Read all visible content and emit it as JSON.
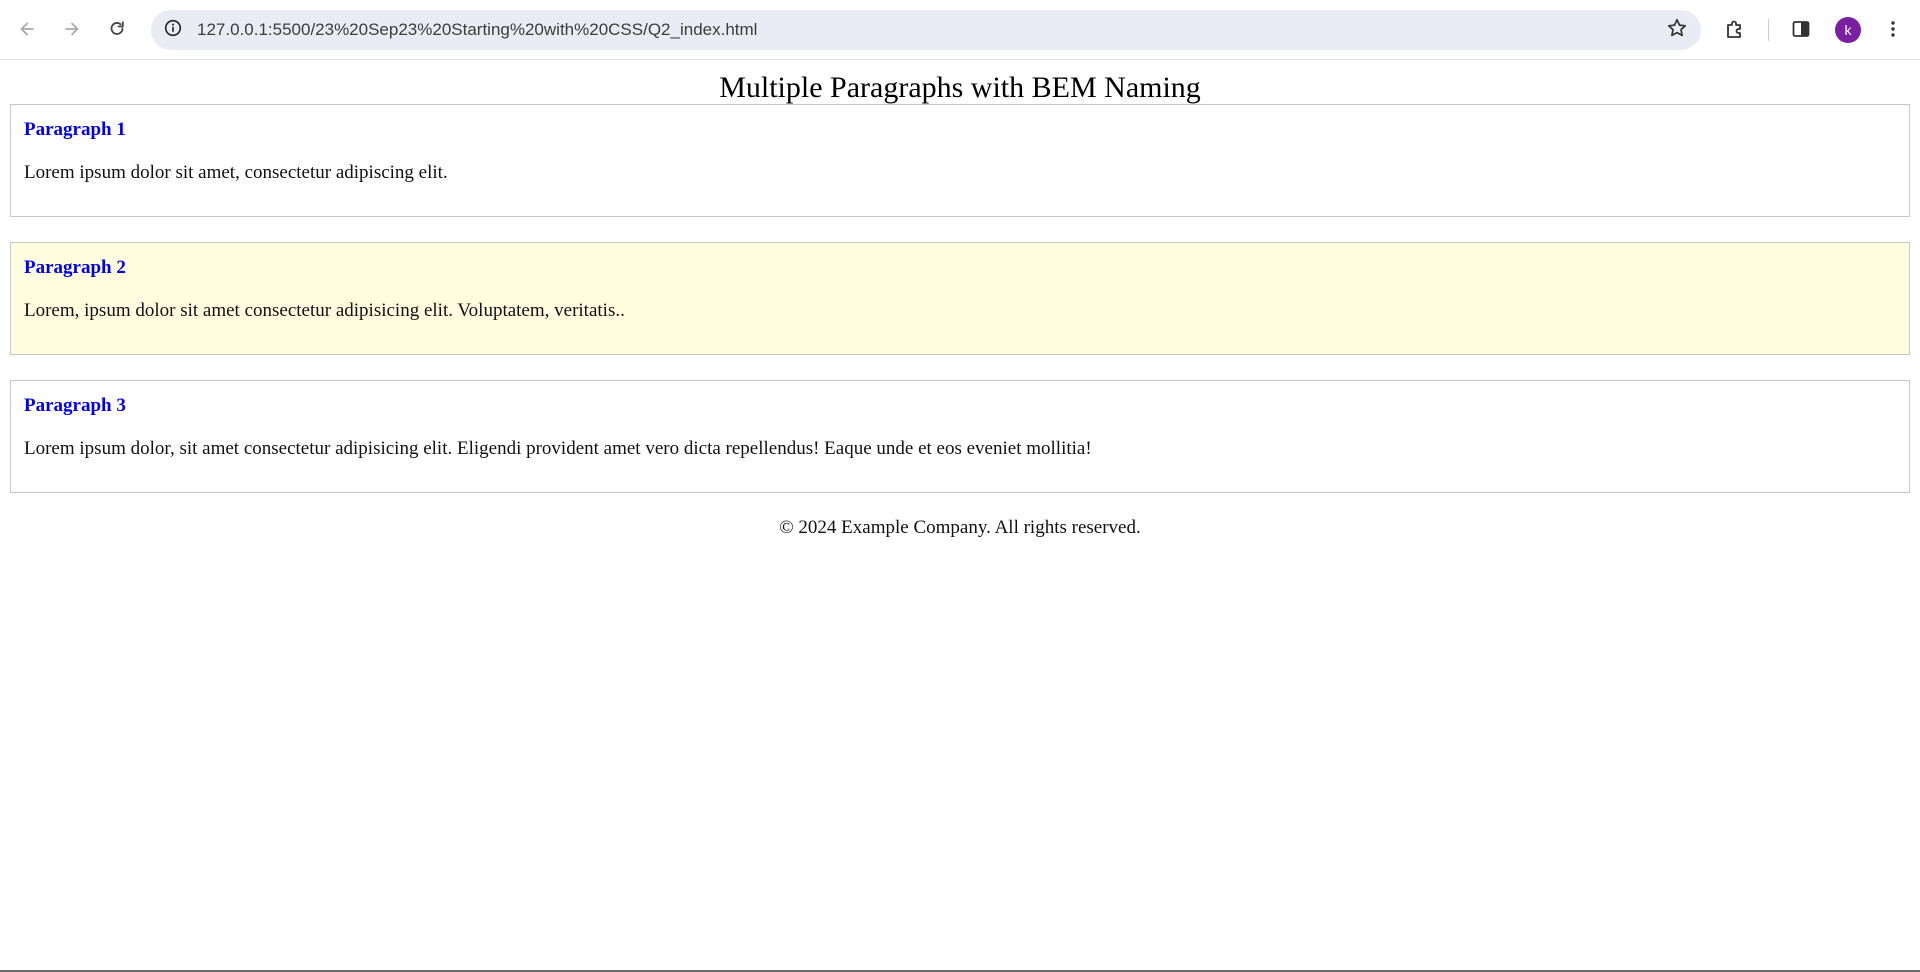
{
  "browser": {
    "url": "127.0.0.1:5500/23%20Sep23%20Starting%20with%20CSS/Q2_index.html",
    "profile_initial": "k",
    "icons": {
      "back": "arrow-left-icon",
      "forward": "arrow-right-icon",
      "reload": "reload-icon",
      "site_info": "info-icon",
      "bookmark": "star-icon",
      "extensions": "puzzle-icon",
      "side_panel": "side-panel-icon",
      "menu": "kebab-menu-icon"
    },
    "colors": {
      "omnibox_bg": "#e9ecf5",
      "avatar_bg": "#7a1fa2"
    }
  },
  "page": {
    "title": "Multiple Paragraphs with BEM Naming",
    "cards": [
      {
        "title": "Paragraph 1",
        "text": "Lorem ipsum dolor sit amet, consectetur adipiscing elit.",
        "highlighted": false
      },
      {
        "title": "Paragraph 2",
        "text": "Lorem, ipsum dolor sit amet consectetur adipisicing elit. Voluptatem, veritatis..",
        "highlighted": true
      },
      {
        "title": "Paragraph 3",
        "text": "Lorem ipsum dolor, sit amet consectetur adipisicing elit. Eligendi provident amet vero dicta repellendus! Eaque unde et eos eveniet mollitia!",
        "highlighted": false
      }
    ],
    "footer": "© 2024 Example Company. All rights reserved.",
    "colors": {
      "card_title": "#0000ee",
      "highlight_bg": "#fffde0",
      "card_border": "#c8c8c8"
    }
  }
}
